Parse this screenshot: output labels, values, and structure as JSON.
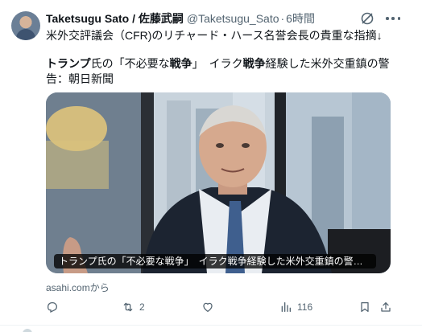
{
  "post": {
    "display_name": "Taketsugu Sato / 佐藤武嗣",
    "handle": "@Taketsugu_Sato",
    "separator": "·",
    "time": "6時間",
    "text": "米外交評議会（CFR)のリチャード・ハース名誉会長の貴重な指摘↓",
    "article_title_parts": [
      "トランプ",
      "氏の「不必要な",
      "戦争",
      "」　イラク",
      "戦争",
      "経験した米外交重鎮の警告：朝日新聞"
    ],
    "card": {
      "caption": "トランプ氏の「不必要な戦争」　イラク戦争経験した米外交重鎮の警告：朝日新聞",
      "source": "asahi.comから"
    },
    "actions": {
      "reply": {
        "icon": "reply-icon",
        "count": ""
      },
      "repost": {
        "icon": "repost-icon",
        "count": "2"
      },
      "like": {
        "icon": "heart-icon",
        "count": ""
      },
      "views": {
        "icon": "views-icon",
        "count": "116"
      },
      "bookmark": {
        "icon": "bookmark-icon"
      },
      "share": {
        "icon": "share-icon"
      }
    }
  },
  "colors": {
    "text": "#0f1419",
    "secondary": "#536471",
    "divider": "#eff3f4"
  }
}
